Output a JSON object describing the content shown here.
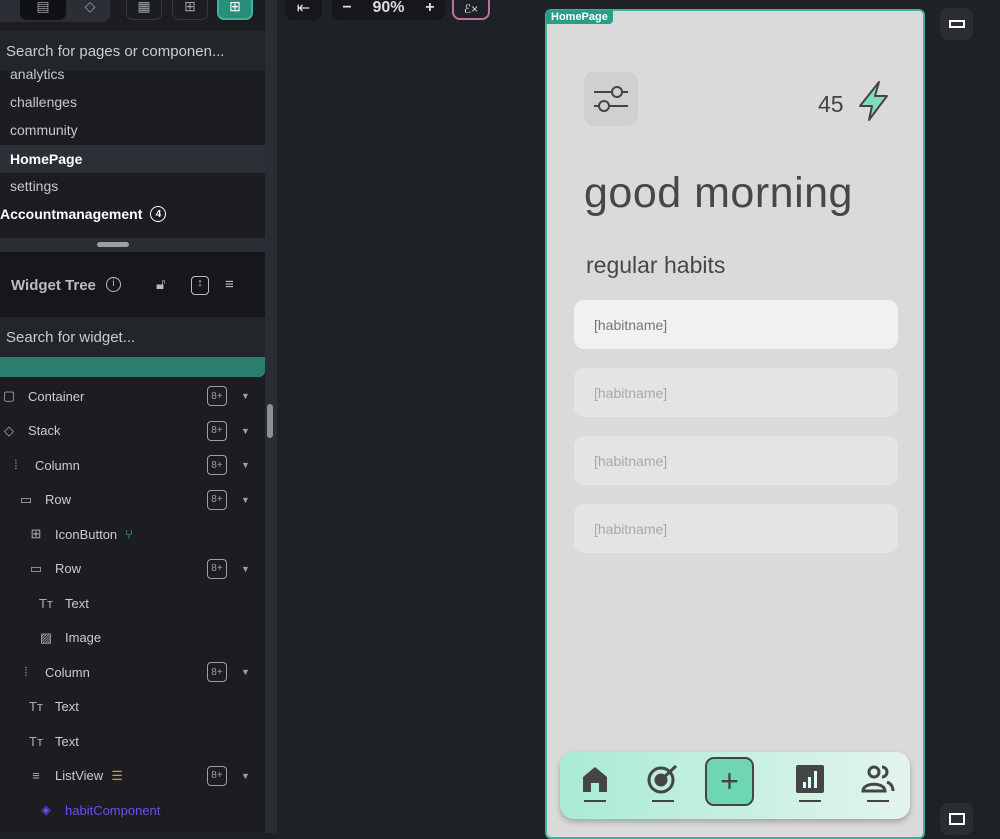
{
  "sidebar": {
    "search_pages_placeholder": "Search for pages or componen...",
    "pages": [
      "analytics",
      "challenges",
      "community",
      "HomePage",
      "settings"
    ],
    "selected_page": "HomePage",
    "folder": {
      "label": "Accountmanagement",
      "count": "4"
    },
    "widget_tree": {
      "title": "Widget Tree",
      "search_placeholder": "Search for widget...",
      "items": [
        {
          "label": "Container",
          "icon": "container-icon"
        },
        {
          "label": "Stack",
          "icon": "stack-icon"
        },
        {
          "label": "Column",
          "icon": "column-icon"
        },
        {
          "label": "Row",
          "icon": "row-icon"
        },
        {
          "label": "IconButton",
          "icon": "icon-button-icon"
        },
        {
          "label": "Row",
          "icon": "row-icon"
        },
        {
          "label": "Text",
          "icon": "text-icon"
        },
        {
          "label": "Image",
          "icon": "image-icon"
        },
        {
          "label": "Column",
          "icon": "column-icon"
        },
        {
          "label": "Text",
          "icon": "text-icon"
        },
        {
          "label": "Text",
          "icon": "text-icon"
        },
        {
          "label": "ListView",
          "icon": "list-icon"
        },
        {
          "label": "habitComponent",
          "icon": "component-icon"
        }
      ]
    }
  },
  "canvas": {
    "zoom": "90%",
    "page_label": "HomePage"
  },
  "app": {
    "streak": "45",
    "greeting": "good morning",
    "section": "regular habits",
    "habits": [
      "[habitname]",
      "[habitname]",
      "[habitname]",
      "[habitname]"
    ],
    "nav": [
      "home",
      "goals",
      "add",
      "analytics",
      "community"
    ]
  },
  "colors": {
    "accent": "#3eb39b",
    "component": "#6b4ff0",
    "bolt": "#7fdcc0"
  }
}
